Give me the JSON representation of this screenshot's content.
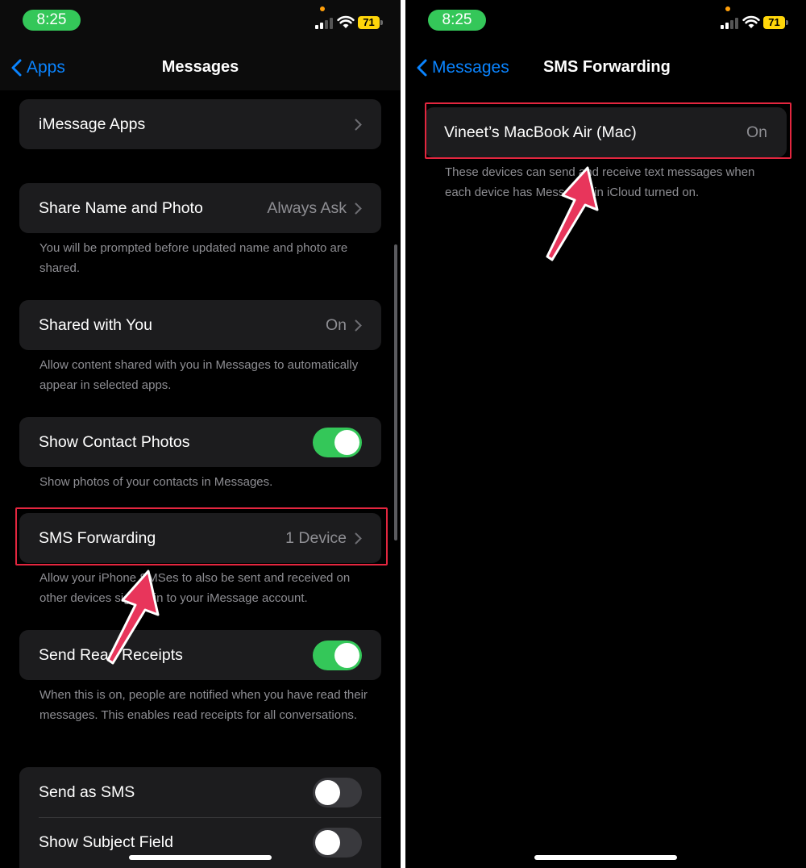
{
  "colors": {
    "background": "#000000",
    "cell": "#1c1c1e",
    "accent": "#0a84ff",
    "toggle_on": "#34c759",
    "toggle_off": "#39393d",
    "secondary_text": "#8e8e93",
    "highlight": "#e3263f",
    "battery": "#ffd60a"
  },
  "left": {
    "status": {
      "time": "8:25",
      "battery": "71"
    },
    "nav": {
      "back_label": "Apps",
      "title": "Messages"
    },
    "imessage_apps": {
      "label": "iMessage Apps"
    },
    "share_name": {
      "label": "Share Name and Photo",
      "value": "Always Ask",
      "footer": "You will be prompted before updated name and photo are shared."
    },
    "shared_with_you": {
      "label": "Shared with You",
      "value": "On",
      "footer": "Allow content shared with you in Messages to automatically appear in selected apps."
    },
    "contact_photos": {
      "label": "Show Contact Photos",
      "toggle": true,
      "footer": "Show photos of your contacts in Messages."
    },
    "sms_forwarding": {
      "label": "SMS Forwarding",
      "value": "1 Device",
      "footer": "Allow your iPhone SMSes to also be sent and received on other devices signed in to your iMessage account."
    },
    "read_receipts": {
      "label": "Send Read Receipts",
      "toggle": true,
      "footer": "When this is on, people are notified when you have read their messages. This enables read receipts for all conversations."
    },
    "send_as_sms": {
      "label": "Send as SMS",
      "toggle": false
    },
    "subject_field": {
      "label": "Show Subject Field",
      "toggle": false
    }
  },
  "right": {
    "status": {
      "time": "8:25",
      "battery": "71"
    },
    "nav": {
      "back_label": "Messages",
      "title": "SMS Forwarding"
    },
    "device": {
      "label": "Vineet’s MacBook Air (Mac)",
      "value": "On"
    },
    "footer": "These devices can send and receive text messages when each device has Messages in iCloud turned on."
  }
}
